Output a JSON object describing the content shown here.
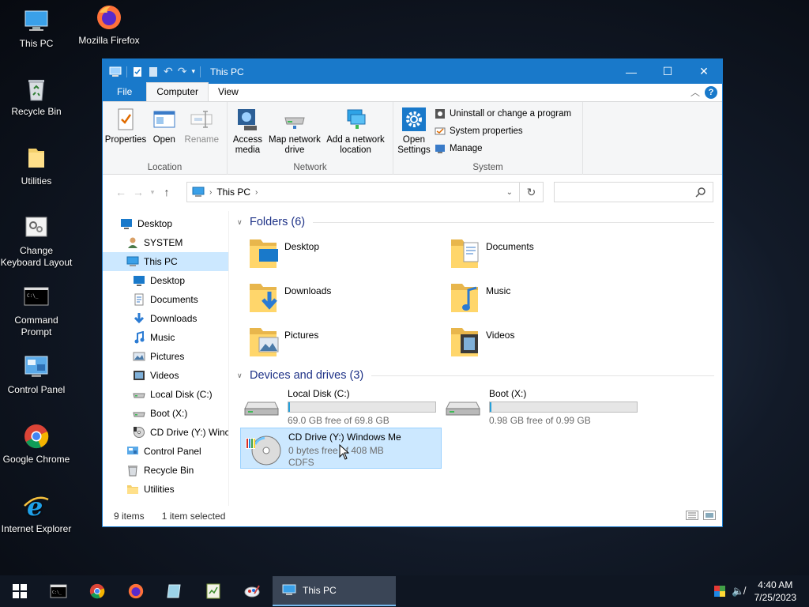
{
  "desktop": {
    "icons": [
      {
        "label": "This PC",
        "icon": "this-pc-icon"
      },
      {
        "label": "Mozilla Firefox",
        "icon": "firefox-icon"
      },
      {
        "label": "Recycle Bin",
        "icon": "recycle-bin-icon"
      },
      {
        "label": "Utilities",
        "icon": "folder-icon"
      },
      {
        "label": "Change Keyboard Layout",
        "icon": "keyboard-layout-icon"
      },
      {
        "label": "Command Prompt",
        "icon": "cmd-icon"
      },
      {
        "label": "Control Panel",
        "icon": "control-panel-icon"
      },
      {
        "label": "Google Chrome",
        "icon": "chrome-icon"
      },
      {
        "label": "Internet Explorer",
        "icon": "ie-icon"
      }
    ]
  },
  "window": {
    "title": "This PC",
    "accent": "#1979ca",
    "controls": {
      "minimize": "—",
      "maximize": "☐",
      "close": "✕"
    }
  },
  "ribbon": {
    "tabs": [
      "File",
      "Computer",
      "View"
    ],
    "active_tab": "Computer",
    "help": "?",
    "groups": {
      "location": {
        "name": "Location",
        "properties": "Properties",
        "open": "Open",
        "rename": "Rename"
      },
      "network": {
        "name": "Network",
        "access_media": "Access media",
        "map_drive": "Map network drive",
        "add_location": "Add a network location"
      },
      "system": {
        "name": "System",
        "open_settings": "Open Settings",
        "uninstall": "Uninstall or change a program",
        "system_properties": "System properties",
        "manage": "Manage"
      }
    }
  },
  "address": {
    "path": "This PC",
    "search_placeholder": ""
  },
  "nav_pane": {
    "items": [
      {
        "label": "Desktop",
        "icon": "desktop-icon",
        "indent": 0
      },
      {
        "label": "SYSTEM",
        "icon": "user-icon",
        "indent": 1
      },
      {
        "label": "This PC",
        "icon": "this-pc-icon",
        "indent": 1,
        "selected": true
      },
      {
        "label": "Desktop",
        "icon": "desktop-icon",
        "indent": 2
      },
      {
        "label": "Documents",
        "icon": "documents-icon",
        "indent": 2
      },
      {
        "label": "Downloads",
        "icon": "downloads-icon",
        "indent": 2
      },
      {
        "label": "Music",
        "icon": "music-icon",
        "indent": 2
      },
      {
        "label": "Pictures",
        "icon": "pictures-icon",
        "indent": 2
      },
      {
        "label": "Videos",
        "icon": "videos-icon",
        "indent": 2
      },
      {
        "label": "Local Disk (C:)",
        "icon": "drive-icon",
        "indent": 2
      },
      {
        "label": "Boot (X:)",
        "icon": "drive-icon",
        "indent": 2
      },
      {
        "label": "CD Drive (Y:) Winc",
        "icon": "cd-drive-icon",
        "indent": 2
      },
      {
        "label": "Control Panel",
        "icon": "control-panel-icon",
        "indent": 1
      },
      {
        "label": "Recycle Bin",
        "icon": "recycle-bin-icon",
        "indent": 1
      },
      {
        "label": "Utilities",
        "icon": "folder-icon",
        "indent": 1
      }
    ]
  },
  "main": {
    "folders_header": "Folders (6)",
    "folders": [
      {
        "label": "Desktop",
        "icon": "desktop-folder-icon"
      },
      {
        "label": "Documents",
        "icon": "documents-folder-icon"
      },
      {
        "label": "Downloads",
        "icon": "downloads-folder-icon"
      },
      {
        "label": "Music",
        "icon": "music-folder-icon"
      },
      {
        "label": "Pictures",
        "icon": "pictures-folder-icon"
      },
      {
        "label": "Videos",
        "icon": "videos-folder-icon"
      }
    ],
    "drives_header": "Devices and drives (3)",
    "drives": [
      {
        "label": "Local Disk (C:)",
        "free": "69.0 GB free of 69.8 GB",
        "used_fraction": 0.011,
        "icon": "hard-drive-icon"
      },
      {
        "label": "Boot (X:)",
        "free": "0.98 GB free of 0.99 GB",
        "used_fraction": 0.01,
        "icon": "hard-drive-icon"
      },
      {
        "label": "CD Drive (Y:) Windows Me",
        "free": "0 bytes free of 408 MB",
        "fs": "CDFS",
        "icon": "cd-drive-icon",
        "selected": true
      }
    ]
  },
  "status": {
    "count": "9 items",
    "selected": "1 item selected"
  },
  "taskbar": {
    "active_label": "This PC",
    "time": "4:40 AM",
    "date": "7/25/2023"
  }
}
